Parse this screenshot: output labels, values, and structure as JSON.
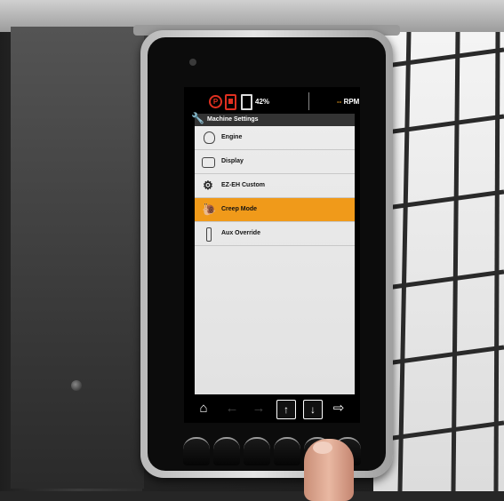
{
  "status_bar": {
    "parking_icon": "parking-brake-icon",
    "parking_label": "P",
    "battery_icon": "battery-warning-icon",
    "fuel_icon": "fuel-icon",
    "fuel_percent": "42%",
    "rpm_value": "--",
    "rpm_unit": "RPM",
    "warning_color": "#e03020"
  },
  "menu": {
    "title": "Machine Settings",
    "title_icon": "wrench-icon",
    "items": [
      {
        "label": "Engine",
        "icon": "engine-icon"
      },
      {
        "label": "Display",
        "icon": "display-icon"
      },
      {
        "label": "EZ-EH Custom",
        "icon": "operator-settings-icon"
      },
      {
        "label": "Creep Mode",
        "icon": "snail-icon",
        "selected": true
      },
      {
        "label": "Aux Override",
        "icon": "aux-icon"
      }
    ],
    "selected_color": "#f09a1a"
  },
  "nav_bar": {
    "home": "home-icon",
    "back": "back-arrow-icon",
    "forward": "forward-arrow-icon",
    "up": "up-arrow-icon",
    "down": "down-arrow-icon",
    "enter": "enter-icon"
  }
}
